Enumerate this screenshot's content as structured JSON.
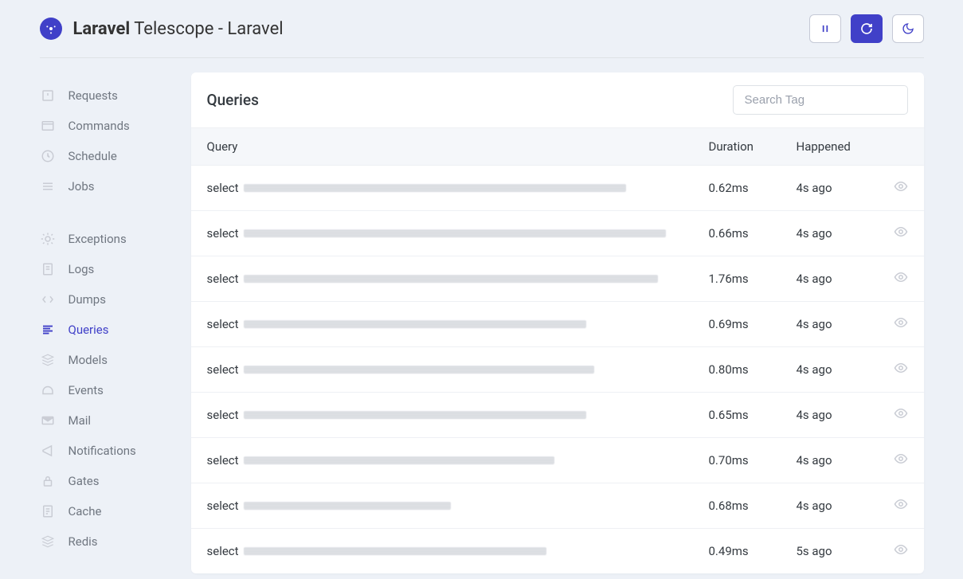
{
  "brand": {
    "bold": "Laravel",
    "rest": " Telescope - Laravel"
  },
  "sidebar": {
    "group1": [
      {
        "label": "Requests"
      },
      {
        "label": "Commands"
      },
      {
        "label": "Schedule"
      },
      {
        "label": "Jobs"
      }
    ],
    "group2": [
      {
        "label": "Exceptions"
      },
      {
        "label": "Logs"
      },
      {
        "label": "Dumps"
      },
      {
        "label": "Queries",
        "active": true
      },
      {
        "label": "Models"
      },
      {
        "label": "Events"
      },
      {
        "label": "Mail"
      },
      {
        "label": "Notifications"
      },
      {
        "label": "Gates"
      },
      {
        "label": "Cache"
      },
      {
        "label": "Redis"
      }
    ]
  },
  "card": {
    "title": "Queries",
    "search_placeholder": "Search Tag",
    "columns": {
      "query": "Query",
      "duration": "Duration",
      "happened": "Happened"
    }
  },
  "rows": [
    {
      "prefix": "select",
      "blur_width": 480,
      "duration": "0.62ms",
      "happened": "4s ago"
    },
    {
      "prefix": "select",
      "blur_width": 530,
      "duration": "0.66ms",
      "happened": "4s ago"
    },
    {
      "prefix": "select",
      "blur_width": 520,
      "duration": "1.76ms",
      "happened": "4s ago"
    },
    {
      "prefix": "select",
      "blur_width": 430,
      "duration": "0.69ms",
      "happened": "4s ago"
    },
    {
      "prefix": "select",
      "blur_width": 440,
      "duration": "0.80ms",
      "happened": "4s ago"
    },
    {
      "prefix": "select",
      "blur_width": 430,
      "duration": "0.65ms",
      "happened": "4s ago"
    },
    {
      "prefix": "select",
      "blur_width": 390,
      "duration": "0.70ms",
      "happened": "4s ago"
    },
    {
      "prefix": "select",
      "blur_width": 260,
      "duration": "0.68ms",
      "happened": "4s ago"
    },
    {
      "prefix": "select",
      "blur_width": 380,
      "duration": "0.49ms",
      "happened": "5s ago"
    }
  ]
}
